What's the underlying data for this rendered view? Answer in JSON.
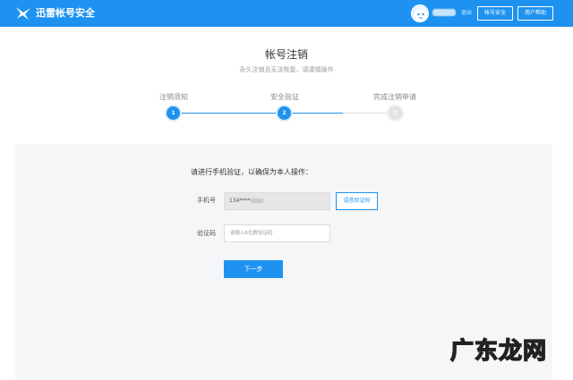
{
  "header": {
    "brand": "迅雷帐号安全",
    "logout": "退出",
    "account_security": "帐号安全",
    "user_help": "用户帮助",
    "accent": "#1e92f0"
  },
  "page": {
    "title": "帐号注销",
    "subtitle": "永久注销且无法恢复，请谨慎操作"
  },
  "steps": [
    {
      "label": "注销须知",
      "number": "1",
      "state": "done"
    },
    {
      "label": "安全验证",
      "number": "2",
      "state": "current"
    },
    {
      "label": "完成注销申请",
      "number": "3",
      "state": "pending"
    }
  ],
  "form": {
    "prompt": "请进行手机验证，以确保为本人操作：",
    "phone_label": "手机号",
    "phone_value": "134****",
    "voice_code_button": "语音验证码",
    "code_label": "验证码",
    "code_placeholder": "请输入6位数验证码",
    "next_button": "下一步"
  },
  "watermark": "广东龙网"
}
